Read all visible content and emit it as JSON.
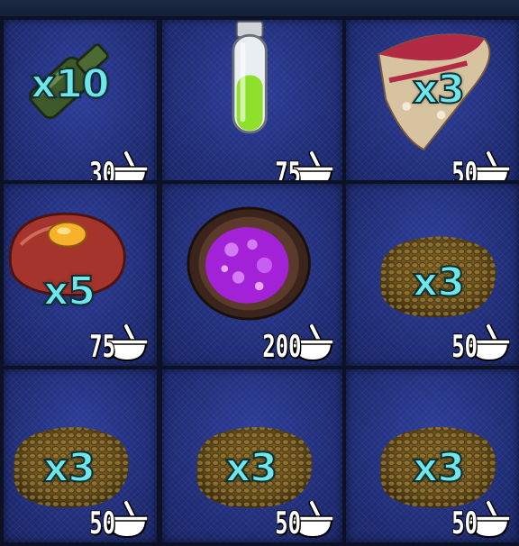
{
  "header": {
    "title": ""
  },
  "slots": [
    {
      "item": "bottle",
      "qty": "x10",
      "cost": "30",
      "icon": "mortar-and-pestle-icon"
    },
    {
      "item": "green-potion-vial",
      "qty": "",
      "cost": "75",
      "icon": "mortar-and-pestle-icon"
    },
    {
      "item": "berry-pie-slice",
      "qty": "x3",
      "cost": "50",
      "icon": "mortar-and-pestle-icon"
    },
    {
      "item": "meat-patty-with-egg",
      "qty": "x5",
      "cost": "75",
      "icon": "mortar-and-pestle-icon"
    },
    {
      "item": "purple-bubbling-bowl",
      "qty": "",
      "cost": "200",
      "icon": "mortar-and-pestle-icon"
    },
    {
      "item": "seed-pile",
      "qty": "x3",
      "cost": "50",
      "icon": "mortar-and-pestle-icon"
    },
    {
      "item": "seed-pile",
      "qty": "x3",
      "cost": "50",
      "icon": "mortar-and-pestle-icon"
    },
    {
      "item": "seed-pile",
      "qty": "x3",
      "cost": "50",
      "icon": "mortar-and-pestle-icon"
    },
    {
      "item": "seed-pile",
      "qty": "x3",
      "cost": "50",
      "icon": "mortar-and-pestle-icon"
    }
  ],
  "colors": {
    "slot_bg": "#222f78",
    "qty_text": "#6fe6ea",
    "cost_text": "#ffffff",
    "border": "#0b1226"
  }
}
